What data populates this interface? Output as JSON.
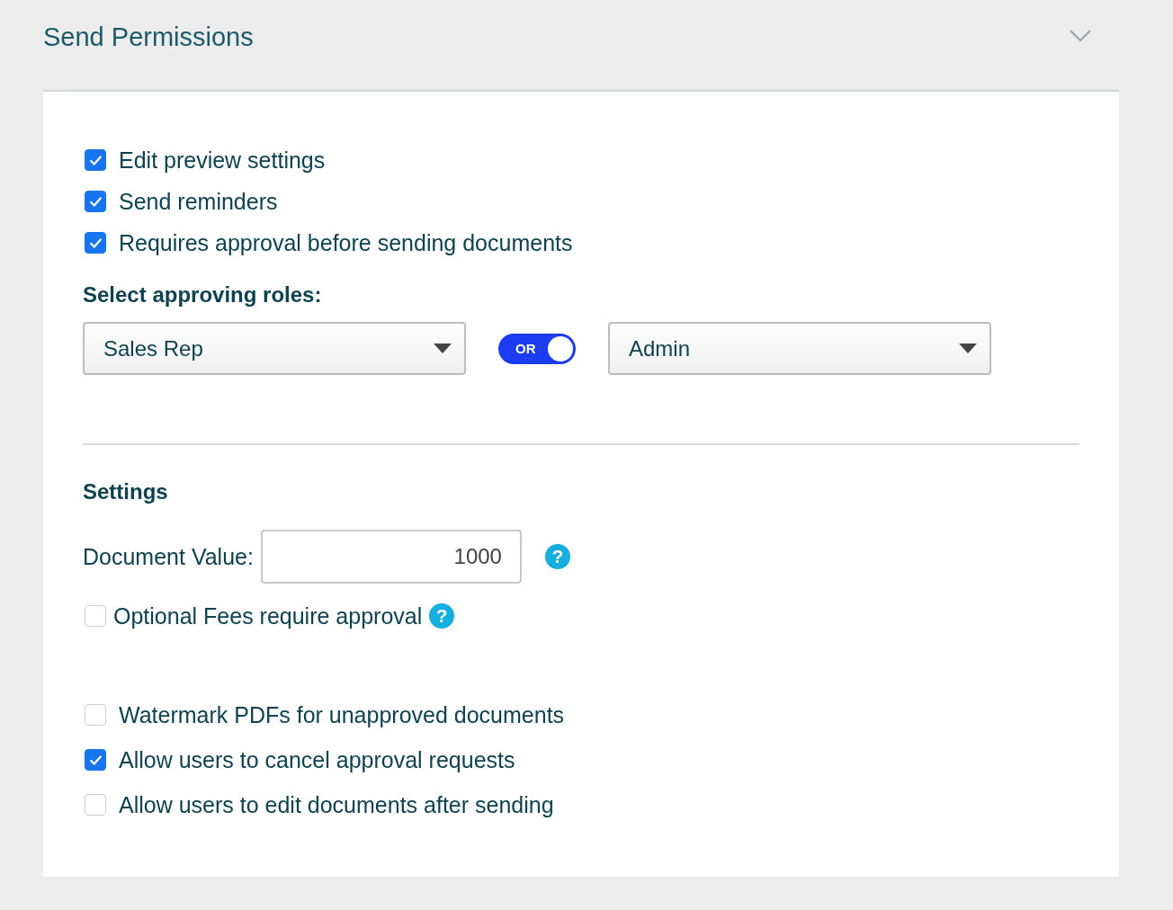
{
  "header": {
    "title": "Send Permissions",
    "expanded": true
  },
  "permissions": [
    {
      "label": "Edit preview settings",
      "checked": true
    },
    {
      "label": "Send reminders",
      "checked": true
    },
    {
      "label": "Requires approval before sending documents",
      "checked": true
    }
  ],
  "approving_roles": {
    "label": "Select approving roles:",
    "first": "Sales Rep",
    "toggle": {
      "label": "OR",
      "on": true
    },
    "second": "Admin"
  },
  "settings": {
    "title": "Settings",
    "document_value": {
      "label": "Document Value:",
      "value": "1000",
      "help": "?"
    },
    "optional_fees": {
      "label": "Optional Fees require approval",
      "checked": false,
      "help": "?"
    },
    "options": [
      {
        "label": "Watermark PDFs for unapproved documents",
        "checked": false
      },
      {
        "label": "Allow users to cancel approval requests",
        "checked": true
      },
      {
        "label": "Allow users to edit documents after sending",
        "checked": false
      }
    ]
  }
}
